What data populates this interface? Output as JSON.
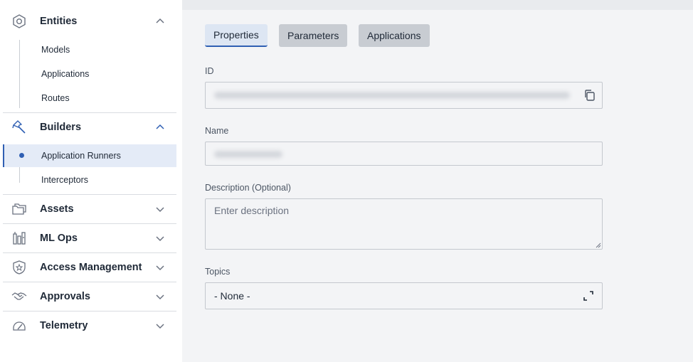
{
  "sidebar": {
    "entities": {
      "title": "Entities",
      "items": [
        "Models",
        "Applications",
        "Routes"
      ]
    },
    "builders": {
      "title": "Builders",
      "items": [
        "Application Runners",
        "Interceptors"
      ]
    },
    "collapsed": [
      "Assets",
      "ML Ops",
      "Access Management",
      "Approvals",
      "Telemetry"
    ]
  },
  "tabs": [
    "Properties",
    "Parameters",
    "Applications"
  ],
  "form": {
    "id_label": "ID",
    "name_label": "Name",
    "description_label": "Description (Optional)",
    "description_placeholder": "Enter description",
    "topics_label": "Topics",
    "topics_value": "- None -"
  },
  "colors": {
    "accent": "#2f5fb3",
    "active_bg": "#e4ebf7",
    "main_bg": "#f3f4f6"
  }
}
